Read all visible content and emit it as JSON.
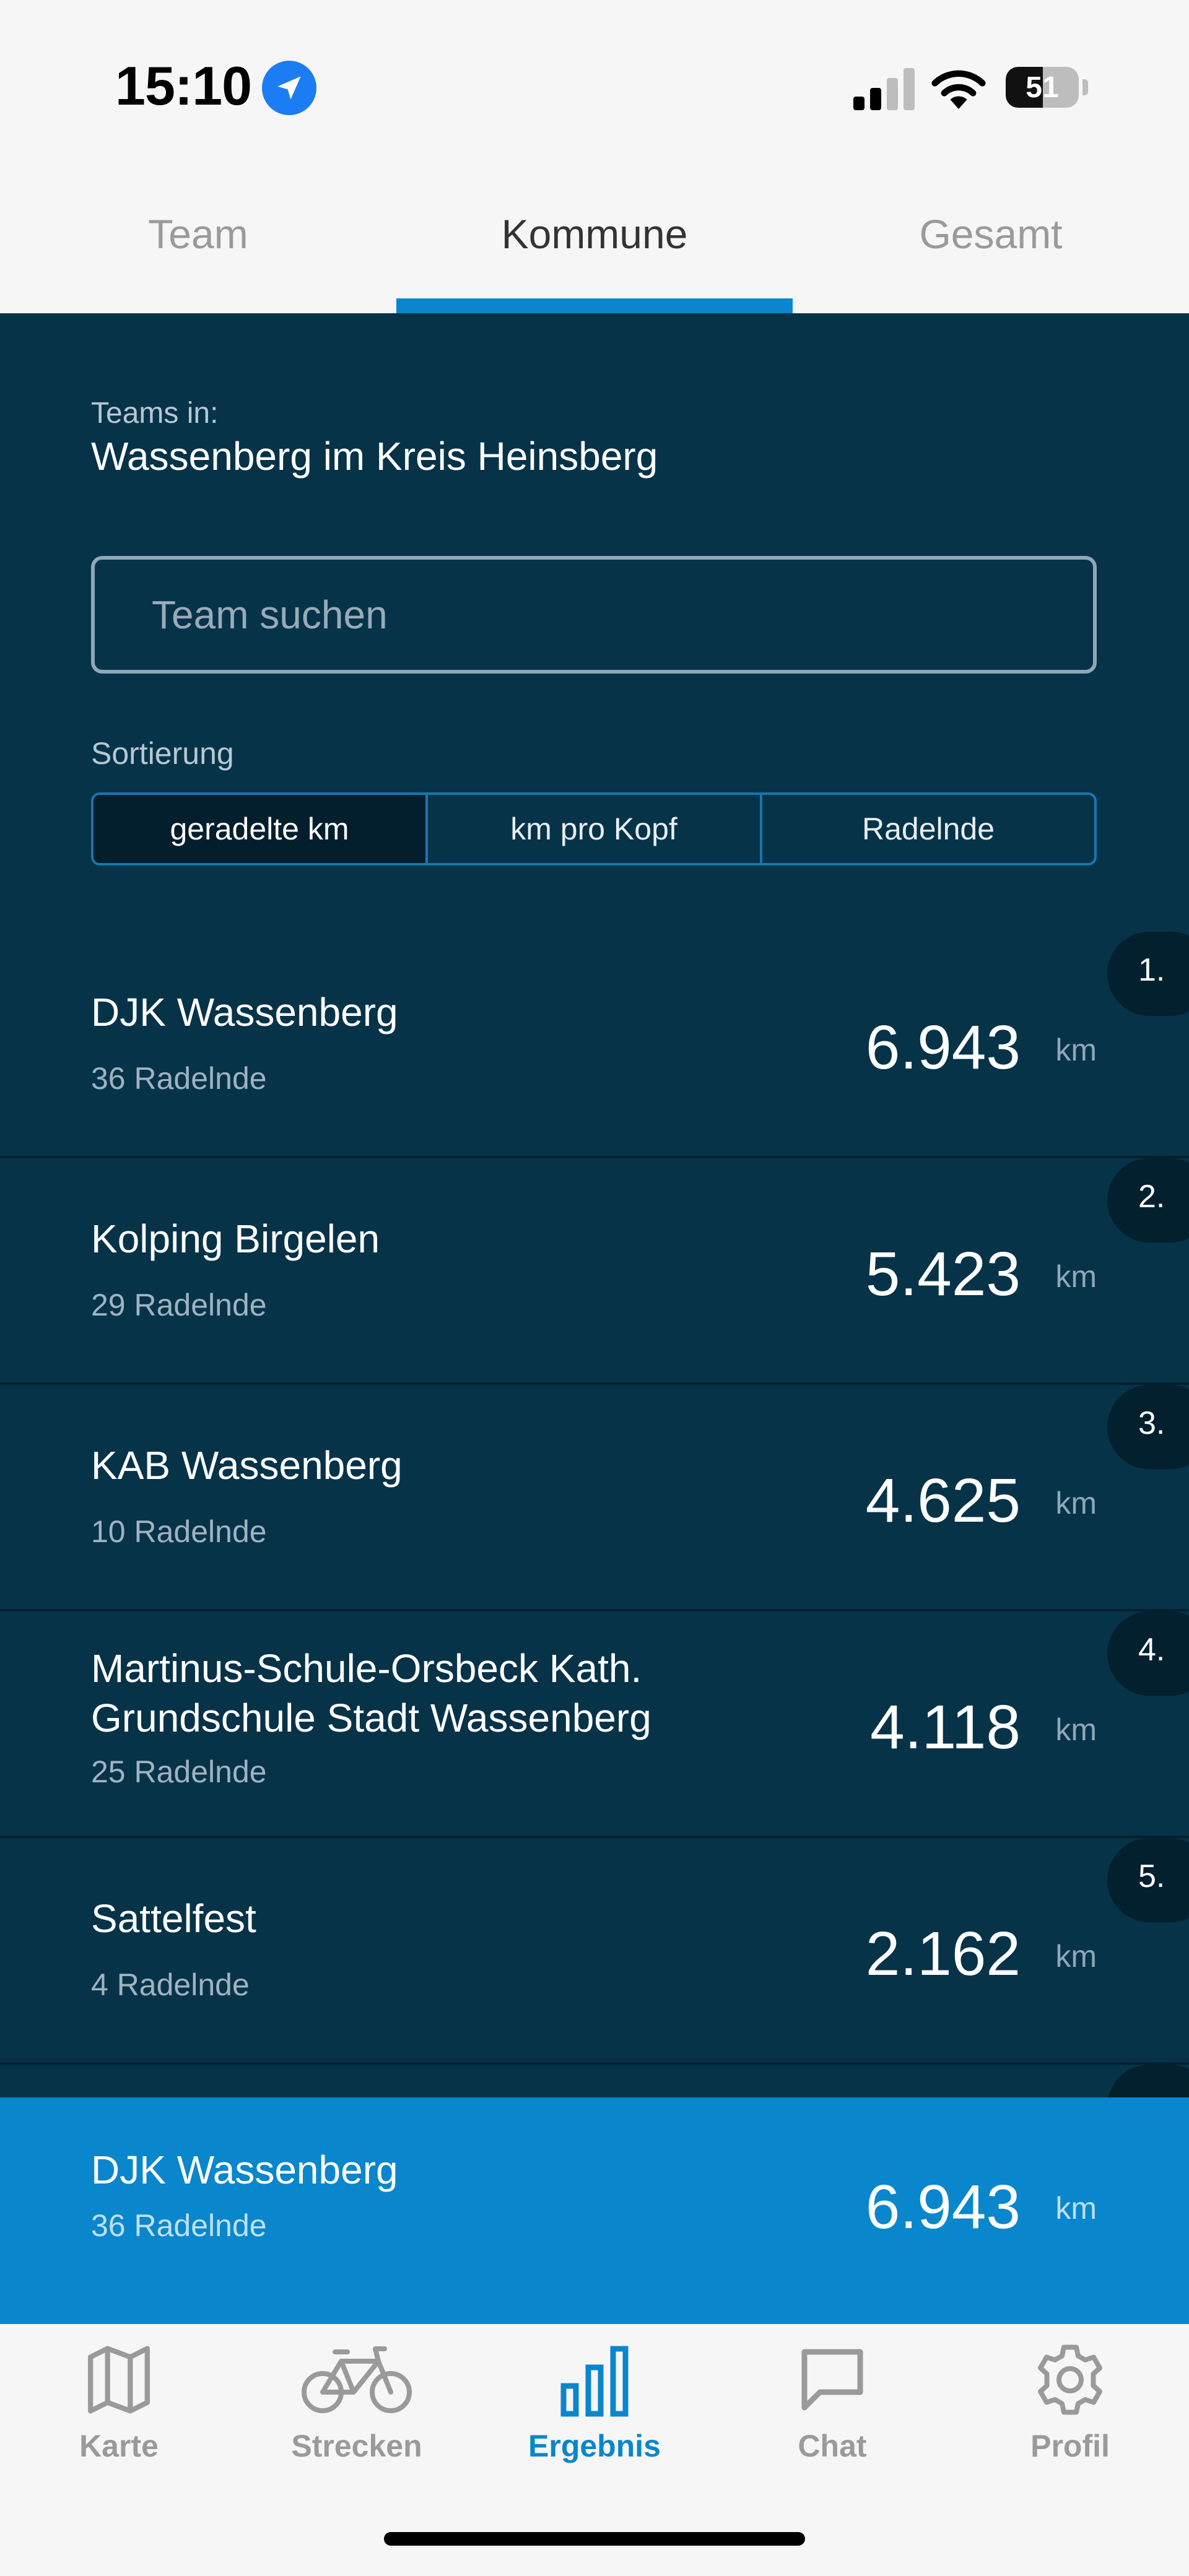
{
  "status_bar": {
    "time": "15:10",
    "battery_level": "51",
    "battery_fraction": 0.51
  },
  "tabs": [
    {
      "label": "Team",
      "active": false
    },
    {
      "label": "Kommune",
      "active": true
    },
    {
      "label": "Gesamt",
      "active": false
    }
  ],
  "header": {
    "teams_in_label": "Teams in:",
    "municipality": "Wassenberg im Kreis Heinsberg"
  },
  "search": {
    "placeholder": "Team suchen",
    "value": ""
  },
  "sorting": {
    "label": "Sortierung",
    "options": [
      "geradelte km",
      "km pro Kopf",
      "Radelnde"
    ],
    "selected": "geradelte km"
  },
  "teams": [
    {
      "rank": "1.",
      "name": "DJK Wassenberg",
      "riders": "36 Radelnde",
      "km": "6.943",
      "unit": "km"
    },
    {
      "rank": "2.",
      "name": "Kolping Birgelen",
      "riders": "29 Radelnde",
      "km": "5.423",
      "unit": "km"
    },
    {
      "rank": "3.",
      "name": "KAB Wassenberg",
      "riders": "10 Radelnde",
      "km": "4.625",
      "unit": "km"
    },
    {
      "rank": "4.",
      "name": "Martinus-Schule-Orsbeck Kath. Grundschule Stadt Wassenberg",
      "riders": "25 Radelnde",
      "km": "4.118",
      "unit": "km"
    },
    {
      "rank": "5.",
      "name": "Sattelfest",
      "riders": "4 Radelnde",
      "km": "2.162",
      "unit": "km"
    }
  ],
  "my_team": {
    "name": "DJK Wassenberg",
    "riders": "36 Radelnde",
    "km": "6.943",
    "unit": "km"
  },
  "bottom_nav": [
    {
      "label": "Karte",
      "icon": "map-icon",
      "active": false
    },
    {
      "label": "Strecken",
      "icon": "bicycle-icon",
      "active": false
    },
    {
      "label": "Ergebnis",
      "icon": "bar-chart-icon",
      "active": true
    },
    {
      "label": "Chat",
      "icon": "chat-bubble-icon",
      "active": false
    },
    {
      "label": "Profil",
      "icon": "gear-icon",
      "active": false
    }
  ],
  "colors": {
    "background": "#073349",
    "accent": "#0a86cc",
    "row_divider": "#03202e",
    "nav_inactive": "#9a9a9a"
  }
}
